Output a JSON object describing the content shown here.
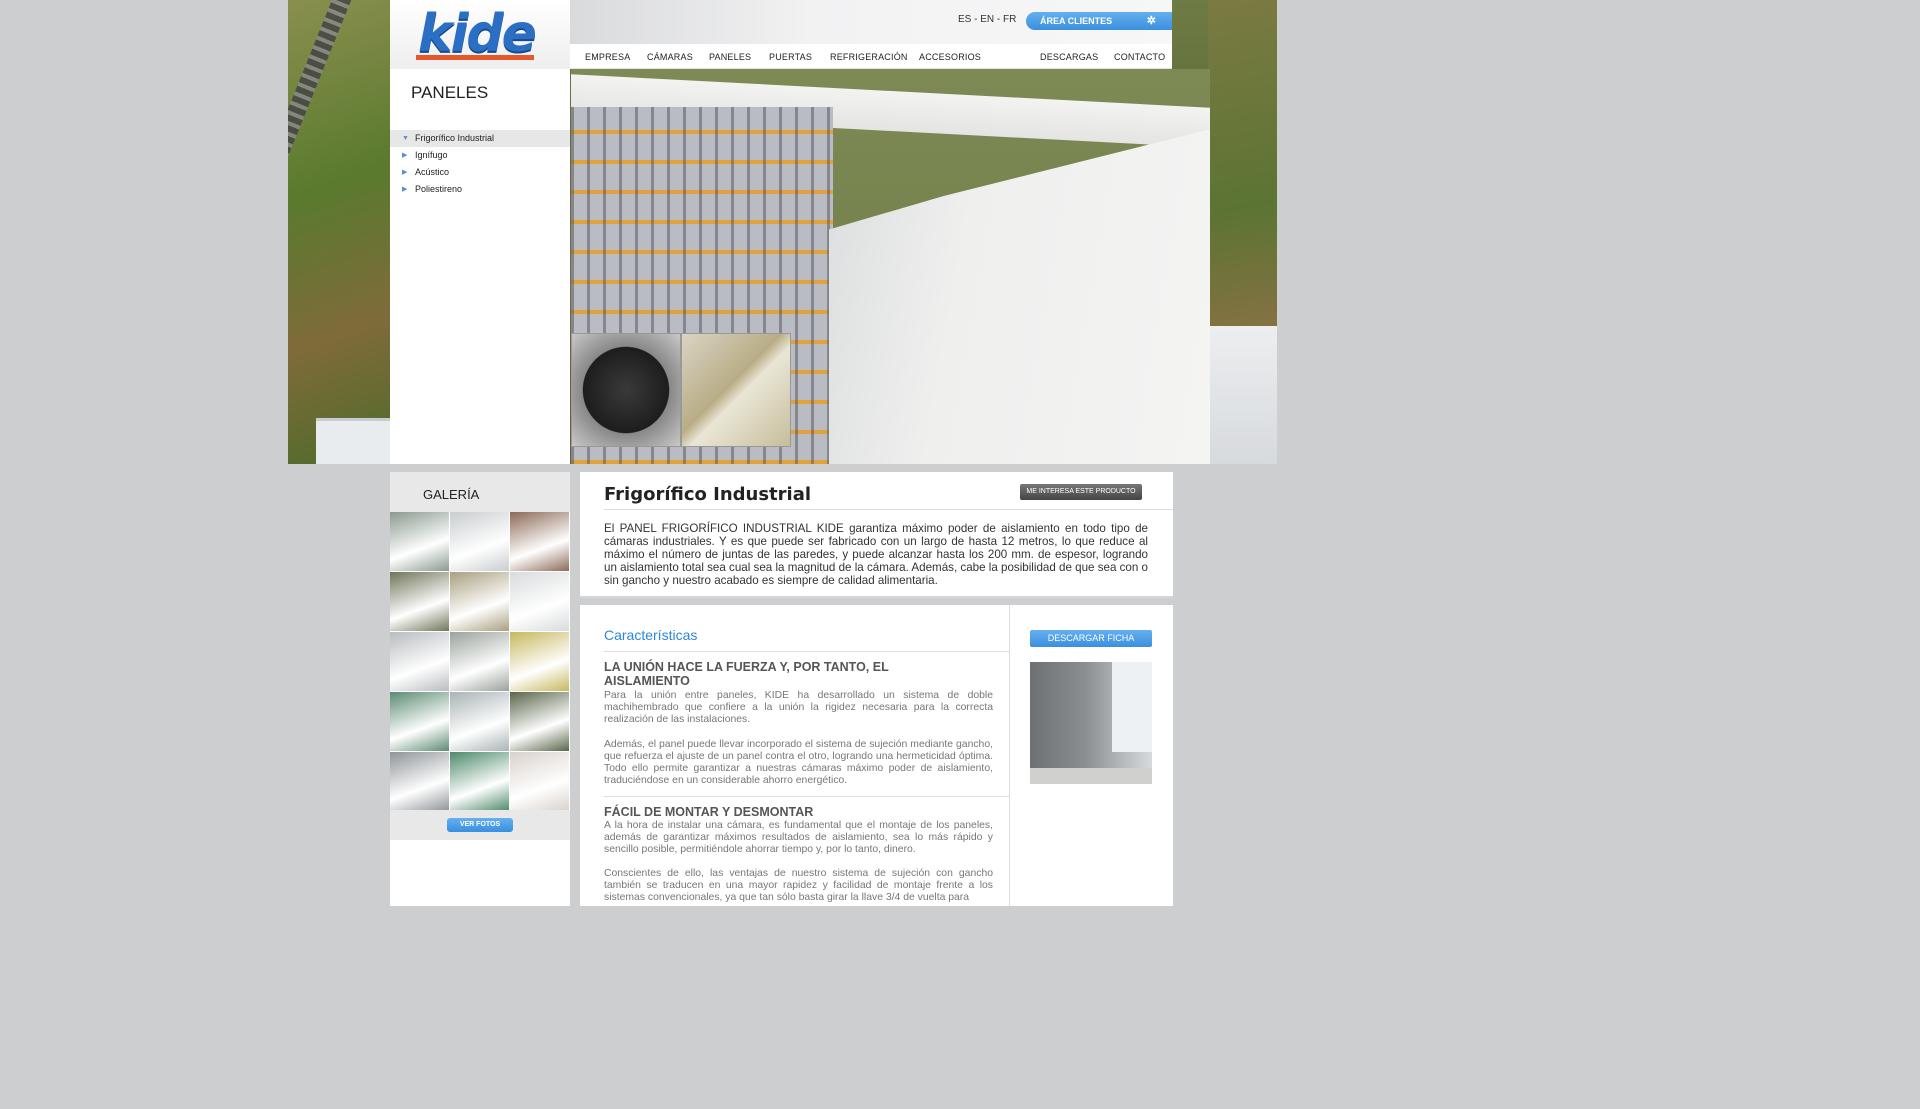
{
  "header": {
    "logo": "kide",
    "languages": [
      "ES",
      "EN",
      "FR"
    ],
    "area_clientes": "ÁREA CLIENTES",
    "nav": [
      "EMPRESA",
      "CÁMARAS",
      "PANELES",
      "PUERTAS",
      "REFRIGERACIÓN",
      "ACCESORIOS",
      "DESCARGAS",
      "CONTACTO"
    ]
  },
  "sidebar": {
    "title": "PANELES",
    "items": [
      {
        "label": "Frigorífico Industrial",
        "active": true
      },
      {
        "label": "Ignífugo",
        "active": false
      },
      {
        "label": "Acústico",
        "active": false
      },
      {
        "label": "Poliestireno",
        "active": false
      }
    ]
  },
  "gallery": {
    "title": "GALERÍA",
    "button": "VER FOTOS",
    "thumb_colors": [
      "#8a9a8f",
      "#c9cdd0",
      "#8c6a57",
      "#6f7558",
      "#a8a080",
      "#d8dbdc",
      "#b8bcc0",
      "#9aa29c",
      "#c7b85e",
      "#5b8b72",
      "#a9b3b6",
      "#59664a",
      "#8f9498",
      "#4d8a6a",
      "#d9d2cc"
    ]
  },
  "product": {
    "title": "Frigorífico Industrial",
    "interest_button": "ME INTERESA ESTE PRODUCTO",
    "description": "El PANEL FRIGORÍFICO INDUSTRIAL KIDE garantiza máximo poder de aislamiento en todo tipo de cámaras industriales. Y es que puede ser fabricado con un largo de hasta 12 metros, lo que reduce al máximo el número de juntas de las paredes, y puede alcanzar hasta los 200 mm. de espesor, logrando un aislamiento total sea cual sea la magnitud de la cámara. Además, cabe la posibilidad de que sea con o sin gancho y nuestro acabado es siempre de calidad alimentaria."
  },
  "features": {
    "title": "Características",
    "download_button": "DESCARGAR FICHA",
    "sections": [
      {
        "heading": "LA UNIÓN HACE LA FUERZA Y, POR TANTO, EL AISLAMIENTO",
        "p1": "Para la unión entre paneles, KIDE ha desarrollado un sistema de doble machihembrado que confiere a la unión la rigidez necesaria para la correcta realización de las instalaciones.",
        "p2": "Además, el panel puede llevar incorporado el sistema de sujeción mediante gancho, que refuerza el ajuste de un panel contra el otro, logrando una hermeticidad óptima. Todo ello permite garantizar a nuestras cámaras máximo poder de aislamiento, traduciéndose en un considerable ahorro energético."
      },
      {
        "heading": "FÁCIL DE MONTAR Y DESMONTAR",
        "p1": "A la hora de instalar una cámara, es fundamental que el montaje de los paneles, además de garantizar máximos resultados de aislamiento, sea lo más rápido y sencillo posible, permitiéndole ahorrar tiempo y, por lo tanto, dinero.",
        "p2": "Conscientes de ello, las ventajas de nuestro sistema de sujeción con gancho también se traducen en una mayor rapidez y facilidad de montaje frente a los sistemas convencionales, ya que tan sólo basta girar la llave 3/4 de vuelta para"
      }
    ]
  }
}
